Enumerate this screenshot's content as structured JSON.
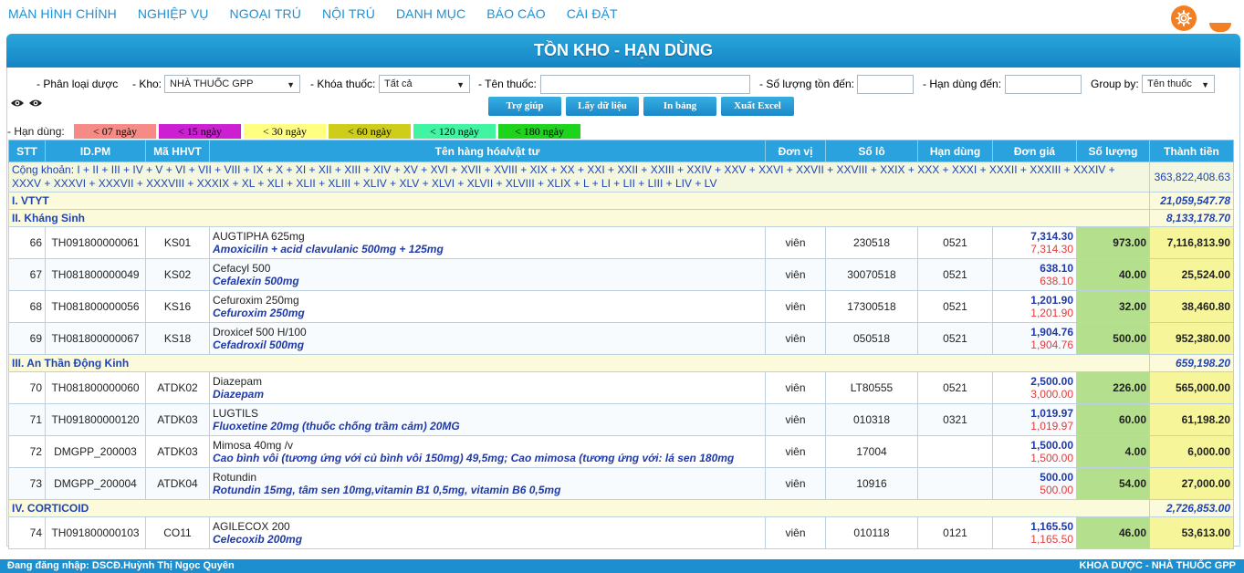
{
  "nav": [
    "MÀN HÌNH CHÍNH",
    "NGHIỆP VỤ",
    "NGOẠI TRÚ",
    "NỘI TRÚ",
    "DANH MỤC",
    "BÁO CÁO",
    "CÀI ĐẶT"
  ],
  "title": "TỒN KHO - HẠN DÙNG",
  "filters": {
    "phan_loai_label": "- Phân loại dược",
    "kho_label": "- Kho:",
    "kho_value": "NHÀ THUỐC GPP",
    "khoa_label": "- Khóa thuốc:",
    "khoa_value": "Tất cả",
    "ten_thuoc_label": "- Tên thuốc:",
    "so_luong_label": "- Số lượng tồn đến:",
    "han_dung_label": "- Hạn dùng đến:",
    "group_label": "Group by:",
    "group_value": "Tên thuốc"
  },
  "buttons": {
    "help": "Trợ giúp",
    "fetch": "Lấy dữ liệu",
    "print": "In bảng",
    "excel": "Xuất Excel"
  },
  "legend": {
    "label": "- Hạn dùng:",
    "items": [
      {
        "text": "< 07 ngày",
        "color": "#f58b84"
      },
      {
        "text": "< 15 ngày",
        "color": "#cc1fd2"
      },
      {
        "text": "< 30 ngày",
        "color": "#ffff80"
      },
      {
        "text": "< 60 ngày",
        "color": "#cdcd1a"
      },
      {
        "text": "< 120 ngày",
        "color": "#41f4a1"
      },
      {
        "text": "< 180 ngày",
        "color": "#1ed31e"
      }
    ]
  },
  "table": {
    "headers": [
      "STT",
      "ID.PM",
      "Mã HHVT",
      "Tên hàng hóa/vật tư",
      "Đơn vị",
      "Số lô",
      "Hạn dùng",
      "Đơn giá",
      "Số lượng",
      "Thành tiền"
    ],
    "sum_label": "Cộng khoản: I + II + III + IV + V + VI + VII + VIII + IX + X + XI + XII + XIII + XIV + XV + XVI + XVII + XVIII + XIX + XX + XXI + XXII + XXIII + XXIV + XXV + XXVI + XXVII + XXVIII + XXIX + XXX + XXXI + XXXII + XXXIII + XXXIV + XXXV + XXXVI + XXXVII + XXXVIII + XXXIX + XL + XLI + XLII + XLIII + XLIV + XLV + XLVI + XLVII + XLVIII + XLIX + L + LI + LII + LIII + LIV + LV",
    "sum_value": "363,822,408.63",
    "groups": {
      "g1": {
        "label": "I. VTYT",
        "value": "21,059,547.78"
      },
      "g2": {
        "label": "II. Kháng Sinh",
        "value": "8,133,178.70"
      },
      "g3": {
        "label": "III. An Thần Động Kinh",
        "value": "659,198.20"
      },
      "g4": {
        "label": "IV. CORTICOID",
        "value": "2,726,853.00"
      }
    },
    "rows": [
      {
        "stt": "66",
        "id": "TH091800000061",
        "ma": "KS01",
        "name": "AUGTIPHA 625mg",
        "active": "Amoxicilin + acid clavulanic 500mg + 125mg",
        "unit": "viên",
        "lot": "230518",
        "exp": "0521",
        "price1": "7,314.30",
        "price2": "7,314.30",
        "qty": "973.00",
        "total": "7,116,813.90"
      },
      {
        "stt": "67",
        "id": "TH081800000049",
        "ma": "KS02",
        "name": "Cefacyl 500",
        "active": "Cefalexin 500mg",
        "unit": "viên",
        "lot": "30070518",
        "exp": "0521",
        "price1": "638.10",
        "price2": "638.10",
        "qty": "40.00",
        "total": "25,524.00"
      },
      {
        "stt": "68",
        "id": "TH081800000056",
        "ma": "KS16",
        "name": "Cefuroxim 250mg",
        "active": "Cefuroxim 250mg",
        "unit": "viên",
        "lot": "17300518",
        "exp": "0521",
        "price1": "1,201.90",
        "price2": "1,201.90",
        "qty": "32.00",
        "total": "38,460.80"
      },
      {
        "stt": "69",
        "id": "TH081800000067",
        "ma": "KS18",
        "name": "Droxicef 500 H/100",
        "active": "Cefadroxil 500mg",
        "unit": "viên",
        "lot": "050518",
        "exp": "0521",
        "price1": "1,904.76",
        "price2": "1,904.76",
        "qty": "500.00",
        "total": "952,380.00"
      },
      {
        "stt": "70",
        "id": "TH081800000060",
        "ma": "ATDK02",
        "name": "Diazepam",
        "active": "Diazepam",
        "unit": "viên",
        "lot": "LT80555",
        "exp": "0521",
        "price1": "2,500.00",
        "price2": "3,000.00",
        "qty": "226.00",
        "total": "565,000.00"
      },
      {
        "stt": "71",
        "id": "TH091800000120",
        "ma": "ATDK03",
        "name": "LUGTILS",
        "active": "Fluoxetine 20mg (thuốc chống trầm cảm) 20MG",
        "unit": "viên",
        "lot": "010318",
        "exp": "0321",
        "price1": "1,019.97",
        "price2": "1,019.97",
        "qty": "60.00",
        "total": "61,198.20"
      },
      {
        "stt": "72",
        "id": "DMGPP_200003",
        "ma": "ATDK03",
        "name": "Mimosa 40mg /v",
        "active": "Cao bình vôi (tương ứng với củ bình vôi 150mg) 49,5mg; Cao mimosa (tương ứng với: lá sen 180mg",
        "unit": "viên",
        "lot": "17004",
        "exp": "",
        "price1": "1,500.00",
        "price2": "1,500.00",
        "qty": "4.00",
        "total": "6,000.00"
      },
      {
        "stt": "73",
        "id": "DMGPP_200004",
        "ma": "ATDK04",
        "name": "Rotundin",
        "active": "Rotundin 15mg, tâm sen 10mg,vitamin B1 0,5mg, vitamin B6 0,5mg",
        "unit": "viên",
        "lot": "10916",
        "exp": "",
        "price1": "500.00",
        "price2": "500.00",
        "qty": "54.00",
        "total": "27,000.00"
      },
      {
        "stt": "74",
        "id": "TH091800000103",
        "ma": "CO11",
        "name": "AGILECOX 200",
        "active": "Celecoxib 200mg",
        "unit": "viên",
        "lot": "010118",
        "exp": "0121",
        "price1": "1,165.50",
        "price2": "1,165.50",
        "qty": "46.00",
        "total": "53,613.00"
      }
    ]
  },
  "footer": {
    "left": "Đang đăng nhập: DSCĐ.Huỳnh Thị Ngọc Quyên",
    "right": "KHOA DƯỢC - NHÀ THUỐC GPP"
  },
  "colors": {
    "accent": "#1b8fd0",
    "gear": "#f37f22",
    "qty_bg": "#b4e08d",
    "total_bg": "#f7f59a"
  }
}
